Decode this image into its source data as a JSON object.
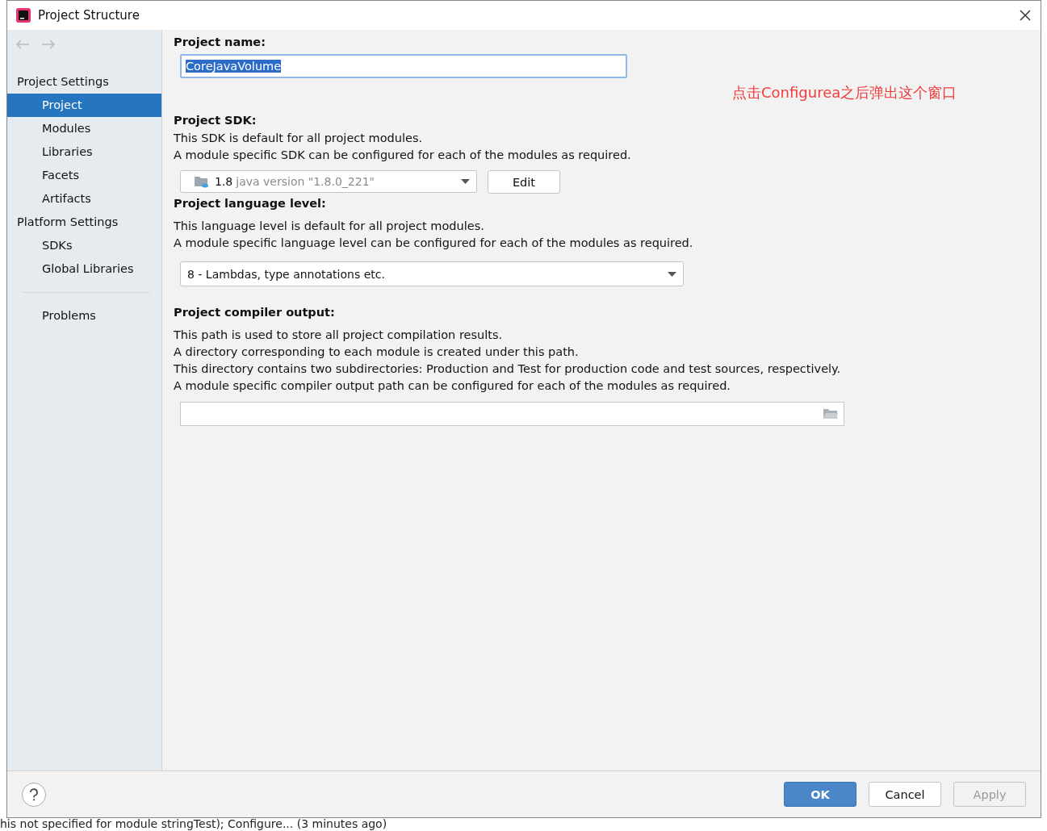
{
  "window": {
    "title": "Project Structure"
  },
  "sidebar": {
    "groups": [
      {
        "title": "Project Settings",
        "items": [
          {
            "label": "Project",
            "selected": true
          },
          {
            "label": "Modules",
            "selected": false
          },
          {
            "label": "Libraries",
            "selected": false
          },
          {
            "label": "Facets",
            "selected": false
          },
          {
            "label": "Artifacts",
            "selected": false
          }
        ]
      },
      {
        "title": "Platform Settings",
        "items": [
          {
            "label": "SDKs",
            "selected": false
          },
          {
            "label": "Global Libraries",
            "selected": false
          }
        ]
      }
    ],
    "extra_items": [
      {
        "label": "Problems",
        "selected": false
      }
    ]
  },
  "project_name": {
    "label": "Project name:",
    "value": "CoreJavaVolume"
  },
  "annotation": "点击Configurea之后弹出这个窗口",
  "project_sdk": {
    "label": "Project SDK:",
    "lines": [
      "This SDK is default for all project modules.",
      "A module specific SDK can be configured for each of the modules as required."
    ],
    "version": "1.8",
    "detail": "java version \"1.8.0_221\"",
    "edit_button": "Edit"
  },
  "language_level": {
    "label": "Project language level:",
    "lines": [
      "This language level is default for all project modules.",
      "A module specific language level can be configured for each of the modules as required."
    ],
    "value": "8 - Lambdas, type annotations etc."
  },
  "compiler_output": {
    "label": "Project compiler output:",
    "lines": [
      "This path is used to store all project compilation results.",
      "A directory corresponding to each module is created under this path.",
      "This directory contains two subdirectories: Production and Test for production code and test sources, respectively.",
      "A module specific compiler output path can be configured for each of the modules as required."
    ]
  },
  "buttons": [
    {
      "label": "OK",
      "kind": "primary",
      "disabled": false
    },
    {
      "label": "Cancel",
      "kind": "normal",
      "disabled": false
    },
    {
      "label": "Apply",
      "kind": "normal",
      "disabled": true
    }
  ],
  "background_status": "his not specified for module stringTest); Configure... (3 minutes ago)"
}
